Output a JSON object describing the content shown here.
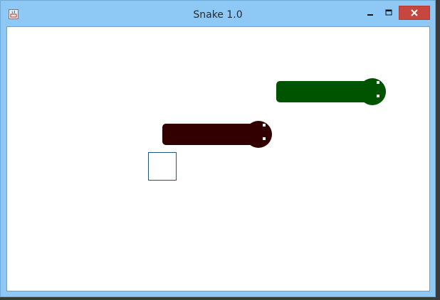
{
  "window": {
    "title": "Snake 1.0",
    "controls": [
      "minimize",
      "maximize",
      "close"
    ]
  },
  "game": {
    "snakes": [
      {
        "color": "#005400"
      },
      {
        "color": "#330000"
      }
    ],
    "food": {
      "color": "#1f5a78"
    }
  }
}
